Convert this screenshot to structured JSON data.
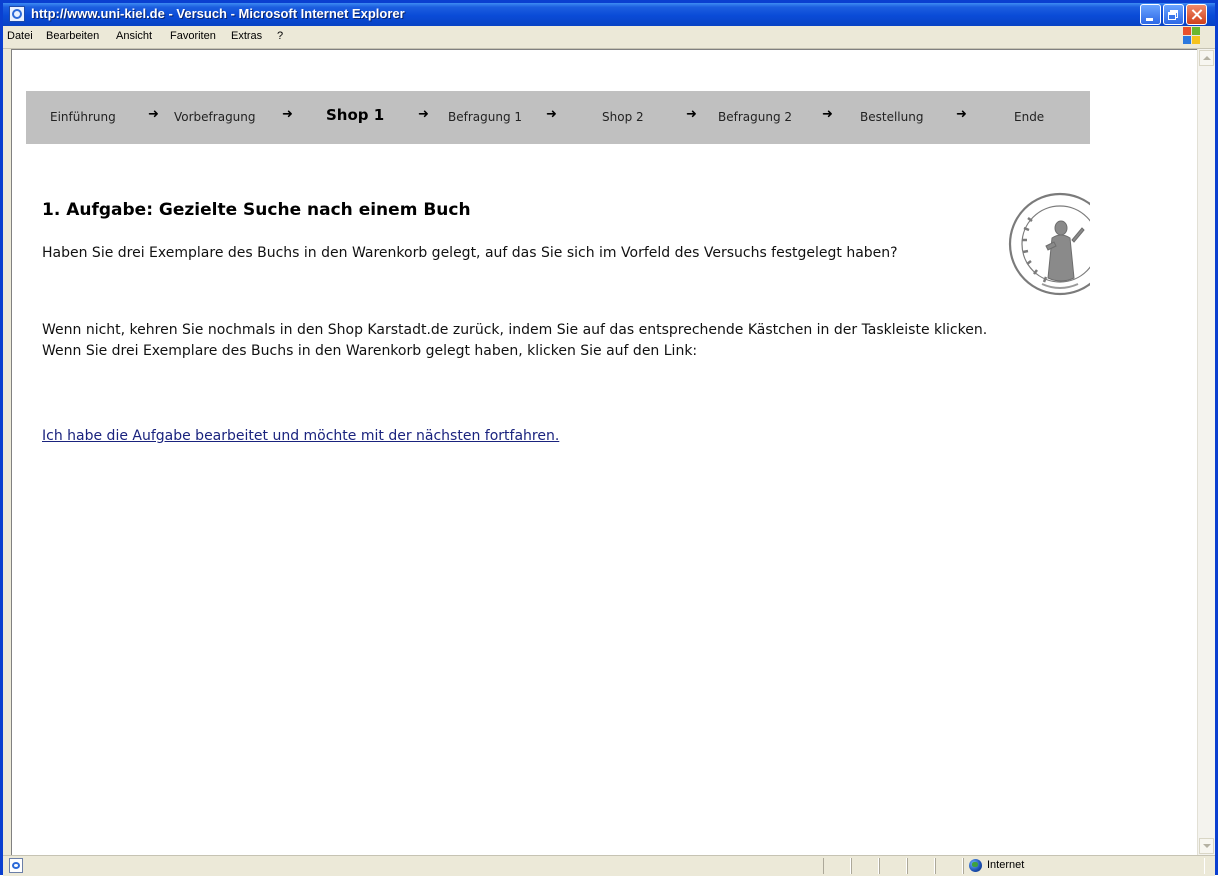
{
  "window": {
    "title": "http://www.uni-kiel.de - Versuch - Microsoft Internet Explorer"
  },
  "menu": {
    "items": [
      "Datei",
      "Bearbeiten",
      "Ansicht",
      "Favoriten",
      "Extras",
      "?"
    ]
  },
  "steps": {
    "items": [
      {
        "label": "Einführung",
        "active": false
      },
      {
        "label": "Vorbefragung",
        "active": false
      },
      {
        "label": "Shop 1",
        "active": true
      },
      {
        "label": "Befragung 1",
        "active": false
      },
      {
        "label": "Shop 2",
        "active": false
      },
      {
        "label": "Befragung 2",
        "active": false
      },
      {
        "label": "Bestellung",
        "active": false
      },
      {
        "label": "Ende",
        "active": false
      }
    ],
    "arrow_glyph": "➜"
  },
  "main": {
    "heading": "1. Aufgabe: Gezielte Suche nach einem Buch",
    "paragraph1": "Haben Sie drei Exemplare des Buchs in den Warenkorb gelegt, auf das Sie sich im Vorfeld des Versuchs festgelegt haben?",
    "paragraph2": "Wenn nicht, kehren Sie nochmals in den Shop Karstadt.de zurück, indem Sie auf das entsprechende Kästchen in der Taskleiste klicken. Wenn Sie drei Exemplare des Buchs in den Warenkorb gelegt haben, klicken Sie auf den Link:",
    "link_text": "Ich habe die Aufgabe bearbeitet und möchte mit der nächsten fortfahren."
  },
  "status": {
    "zone": "Internet"
  },
  "icons": {
    "page": "ie-page-icon",
    "logo": "windows-logo-icon",
    "seal": "university-seal-icon",
    "zone": "globe-icon"
  },
  "colors": {
    "titlebar": "#0a4bd7",
    "stepbar": "#c0c0c0",
    "link": "#1a237e"
  }
}
